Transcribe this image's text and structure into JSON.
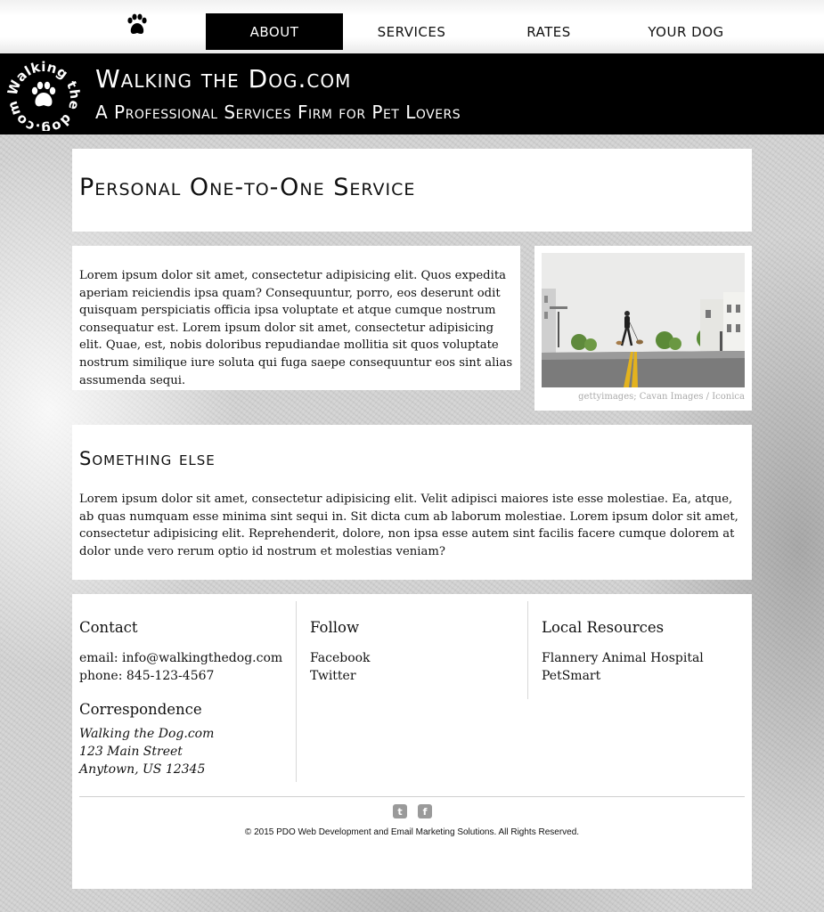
{
  "nav": {
    "items": [
      {
        "label": "ABOUT",
        "active": true
      },
      {
        "label": "SERVICES",
        "active": false
      },
      {
        "label": "RATES",
        "active": false
      },
      {
        "label": "YOUR DOG",
        "active": false
      }
    ],
    "logo_icon": "paw-icon"
  },
  "header": {
    "logo_text": "Walking the dog.com",
    "title": "Walking the Dog.com",
    "subtitle": "A Professional Services Firm for Pet Lovers"
  },
  "main": {
    "page_title": "Personal One-to-One Service",
    "intro": "Lorem ipsum dolor sit amet, consectetur adipisicing elit. Quos expedita aperiam reiciendis ipsa quam? Consequuntur, porro, eos deserunt odit quisquam perspiciatis officia ipsa voluptate et atque cumque nostrum consequatur est. Lorem ipsum dolor sit amet, consectetur adipisicing elit. Quae, est, nobis doloribus repudiandae mollitia sit quos voluptate nostrum similique iure soluta qui fuga saepe consequuntur eos sint alias assumenda sequi.",
    "photo_caption": "gettyimages; Cavan Images / Iconica",
    "section_title": "Something else",
    "section_text": "Lorem ipsum dolor sit amet, consectetur adipisicing elit. Velit adipisci maiores iste esse molestiae. Ea, atque, ab quas numquam esse minima sint sequi in. Sit dicta cum ab laborum molestiae. Lorem ipsum dolor sit amet, consectetur adipisicing elit. Reprehenderit, dolore, non ipsa esse autem sint facilis facere cumque dolorem at dolor unde vero rerum optio id nostrum et molestias veniam?"
  },
  "footer": {
    "contact": {
      "heading": "Contact",
      "email": "email: info@walkingthedog.com",
      "phone": "phone: 845-123-4567"
    },
    "correspondence": {
      "heading": "Correspondence",
      "lines": [
        "Walking the Dog.com",
        "123 Main Street",
        "Anytown, US 12345"
      ]
    },
    "follow": {
      "heading": "Follow",
      "links": [
        "Facebook",
        "Twitter"
      ]
    },
    "resources": {
      "heading": "Local Resources",
      "links": [
        "Flannery Animal Hospital",
        "PetSmart"
      ]
    },
    "social_icons": [
      {
        "icon": "twitter-icon",
        "glyph": "t"
      },
      {
        "icon": "facebook-icon",
        "glyph": "f"
      }
    ],
    "copyright": "© 2015 PDO Web Development and Email Marketing Solutions. All Rights Reserved."
  },
  "colors": {
    "nav_active_bg": "#000000",
    "banner_bg": "#000000",
    "panel_bg": "#ffffff",
    "caption_text": "#aaaaaa"
  }
}
